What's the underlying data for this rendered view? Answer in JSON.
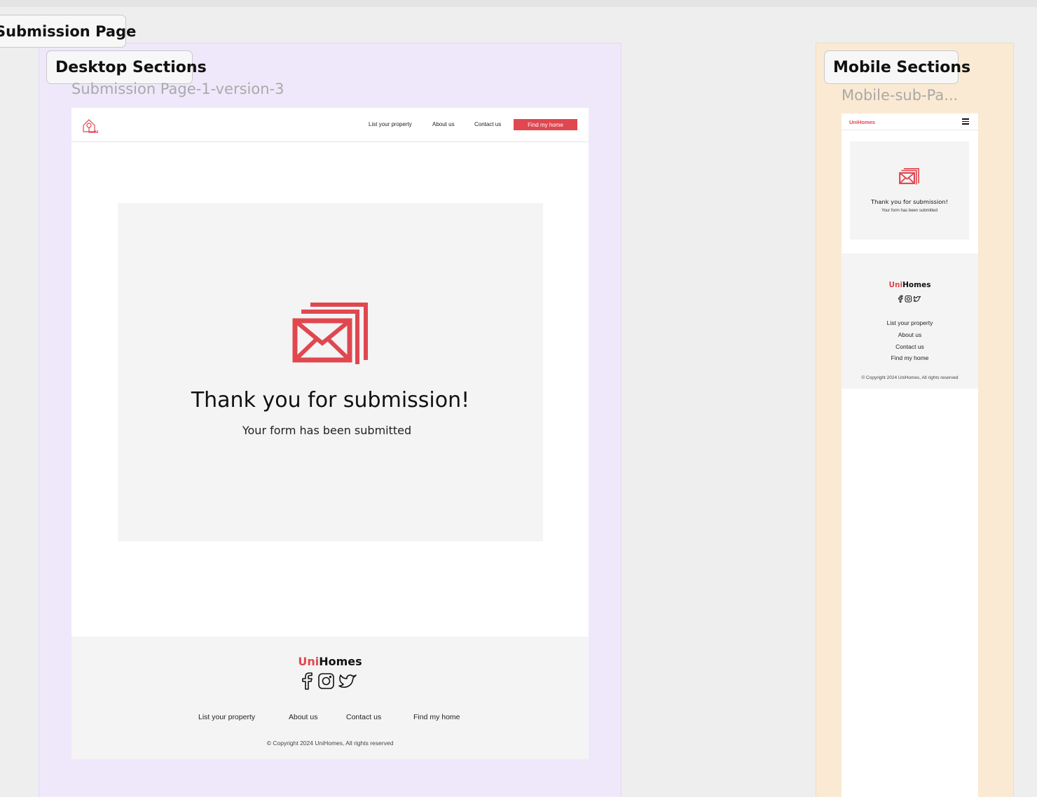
{
  "canvas": {
    "page_label": "Submission Page",
    "desktop_section_label": "Desktop Sections",
    "mobile_section_label": "Mobile Sections",
    "desktop_frame_label": "Submission Page-1-version-3",
    "mobile_frame_label": "Mobile-sub-Pa..."
  },
  "desktop": {
    "nav": {
      "links": [
        "List your property",
        "About us",
        "Contact us"
      ],
      "cta": "Find my home"
    },
    "card": {
      "title": "Thank you for submission!",
      "subtitle": "Your form has been submitted"
    },
    "footer": {
      "brand_prefix": "Uni",
      "brand_suffix": "Homes",
      "links": [
        "List your property",
        "About us",
        "Contact us",
        "Find my home"
      ],
      "copyright": "© Copyright 2024 UniHomes, All rights reserved"
    }
  },
  "mobile": {
    "nav": {
      "logo": "UniHomes"
    },
    "card": {
      "title": "Thank you for submission!",
      "subtitle": "Your form has been submitted"
    },
    "footer": {
      "brand_prefix": "Uni",
      "brand_suffix": "Homes",
      "links": [
        "List your property",
        "About us",
        "Contact us",
        "Find my home"
      ],
      "copyright": "© Copyright 2024 UniHomes, All rights reserved"
    }
  },
  "colors": {
    "accent": "#e0474f",
    "desktop_section_bg": "#efe8fa",
    "mobile_section_bg": "#fbead3",
    "card_bg": "#f4f4f4"
  },
  "icons": [
    "house-key-logo-icon",
    "mail-stack-icon",
    "facebook-icon",
    "instagram-icon",
    "twitter-icon",
    "hamburger-menu-icon"
  ]
}
